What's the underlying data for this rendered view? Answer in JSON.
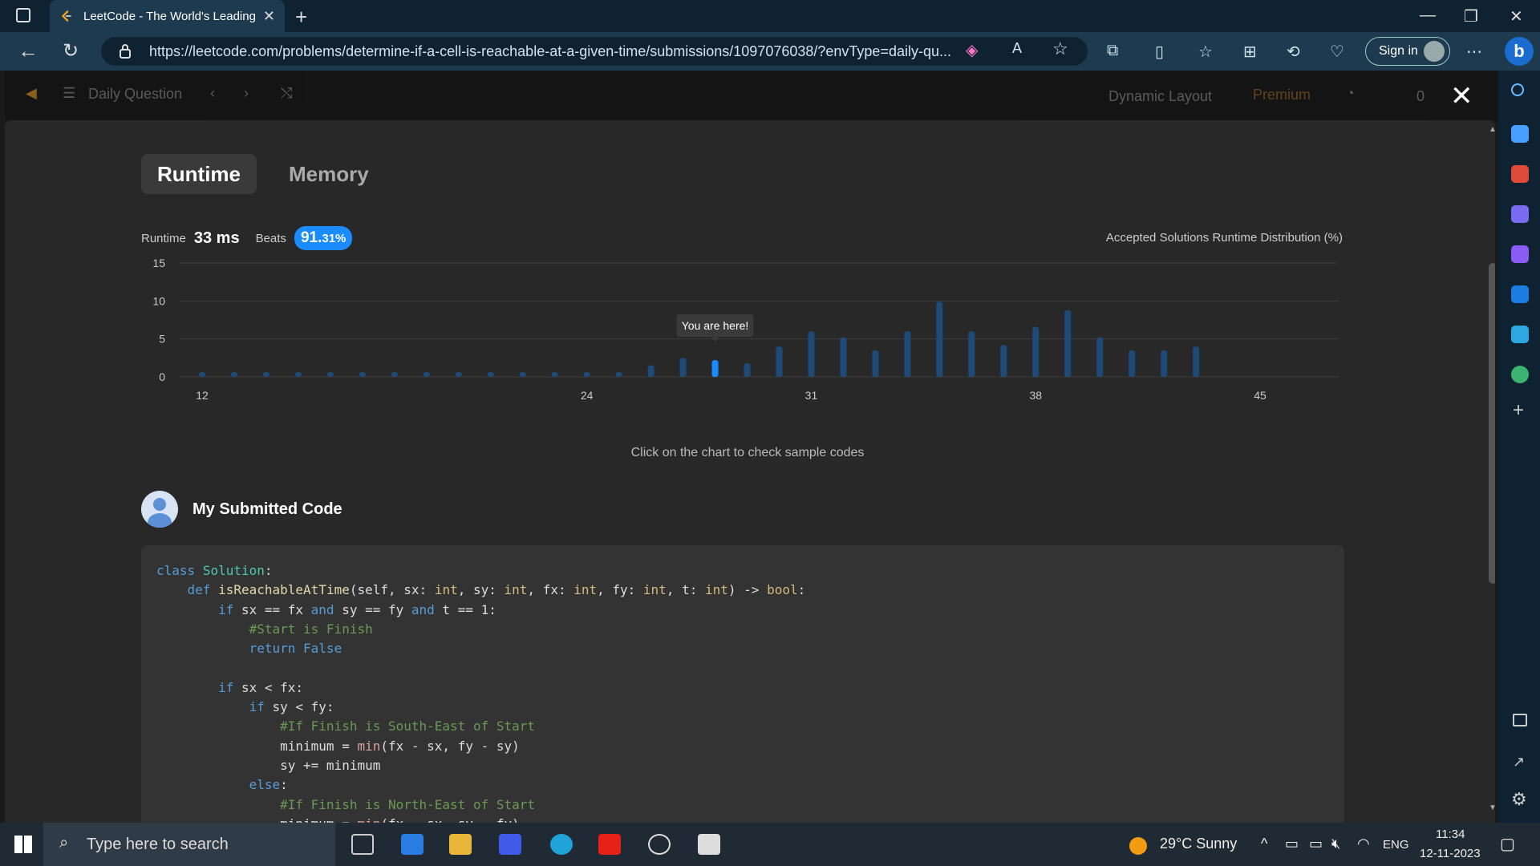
{
  "browser": {
    "tab_title": "LeetCode - The World's Leading",
    "url": "https://leetcode.com/problems/determine-if-a-cell-is-reachable-at-a-given-time/submissions/1097076038/?envType=daily-qu...",
    "signin_label": "Sign in"
  },
  "lc_header": {
    "daily_question": "Daily Question",
    "dynamic_layout": "Dynamic Layout",
    "premium": "Premium",
    "streak": "0"
  },
  "tabs": {
    "runtime": "Runtime",
    "memory": "Memory"
  },
  "stats": {
    "runtime_label": "Runtime",
    "runtime_value": "33 ms",
    "beats_label": "Beats",
    "beats_value": "91.",
    "beats_decimal": "31%",
    "dist_title": "Accepted Solutions Runtime Distribution (%)"
  },
  "chart_data": {
    "type": "bar",
    "title": "Accepted Solutions Runtime Distribution (%)",
    "x_ticks": [
      "12",
      "24",
      "31",
      "38",
      "45"
    ],
    "y_ticks": [
      "0",
      "5",
      "10",
      "15"
    ],
    "ylim": [
      0,
      15
    ],
    "x_values": [
      12,
      13,
      14,
      15,
      16,
      17,
      18,
      19,
      20,
      21,
      22,
      23,
      24,
      25,
      26,
      27,
      28,
      29,
      30,
      31,
      32,
      33,
      34,
      35,
      36,
      37,
      38,
      39,
      40,
      41,
      42,
      43,
      44,
      45,
      46,
      47
    ],
    "values": [
      0.1,
      0.1,
      0.1,
      0.1,
      0.1,
      0.1,
      0.1,
      0.1,
      0.1,
      0.1,
      0.1,
      0.1,
      0.1,
      0.1,
      1.5,
      2.5,
      2.2,
      1.8,
      4.0,
      6.0,
      5.2,
      3.5,
      6.0,
      9.9,
      6.0,
      4.2,
      6.6,
      8.8,
      5.2,
      3.5,
      3.5,
      4.0
    ],
    "highlight_index": 16,
    "highlight_label": "You are here!",
    "grid": true
  },
  "hint": "Click on the chart to check sample codes",
  "submitted_title": "My Submitted Code",
  "taskbar": {
    "search_placeholder": "Type here to search",
    "weather": "29°C  Sunny",
    "lang": "ENG",
    "time": "11:34",
    "date": "12-11-2023"
  }
}
